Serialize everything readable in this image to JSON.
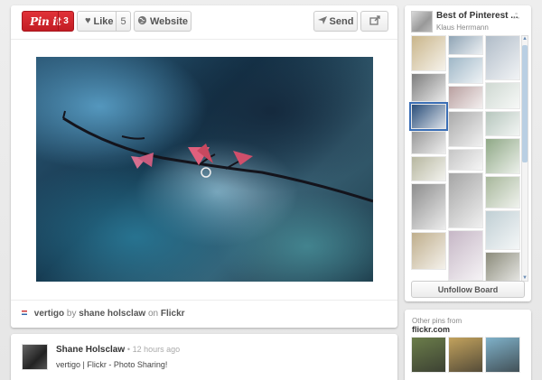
{
  "pin_toolbar": {
    "pinit_label": "Pin it",
    "pinit_count": "3",
    "like_label": "Like",
    "like_count": "5",
    "website_label": "Website",
    "send_label": "Send"
  },
  "pin": {
    "title": "vertigo",
    "by_text": "by",
    "author": "shane holsclaw",
    "on_text": "on",
    "source": "Flickr"
  },
  "comment": {
    "name": "Shane Holsclaw",
    "time": "12 hours ago",
    "text": "vertigo | Flickr - Photo Sharing!"
  },
  "board": {
    "title": "Best of Pinterest ...",
    "owner": "Klaus Herrmann",
    "unfollow_label": "Unfollow Board",
    "thumbs_col1": [
      "#c9b58a",
      "#7d7d7d",
      "#2a4e7a",
      "#9a9a9a",
      "#b7b7a0",
      "#8d8d8d",
      "#bfae8c"
    ],
    "thumbs_col2": [
      "#8fa4b5",
      "#9fb7c7",
      "#b9a0a0",
      "#aaaaaa",
      "#c5c5c5",
      "#a5a5a5",
      "#c6b7c6"
    ],
    "thumbs_col3": [
      "#b0bcc8",
      "#cfd9d2",
      "#b6c6bd",
      "#8fa886",
      "#a7b79b",
      "#c0cfd4",
      "#8b8b7b"
    ],
    "colors": {
      "accent": "#cb2027",
      "scroll": "#b9cfe3"
    }
  },
  "other_pins": {
    "label": "Other pins from",
    "source": "flickr.com",
    "thumbs": [
      "#6b7d4a",
      "#c2a25d",
      "#7fb1c9"
    ]
  }
}
